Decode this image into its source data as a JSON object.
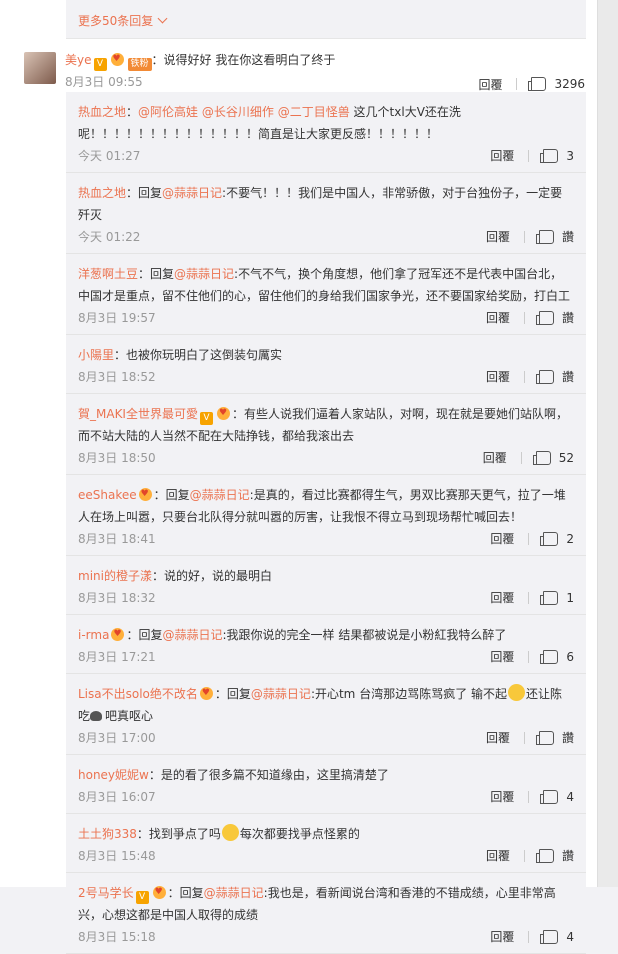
{
  "more": {
    "label": "更多50条回复"
  },
  "main": {
    "user": "美ye",
    "fan_badge": "铁粉",
    "text": "：说得好好 我在你这看明白了终于",
    "time": "8月3日 09:55",
    "reply_label": "回覆",
    "likes": "3296"
  },
  "replies": [
    {
      "user": "热血之地",
      "segments": [
        {
          "t": "："
        },
        {
          "t": "@阿伦高娃",
          "link": true
        },
        {
          "t": " "
        },
        {
          "t": "@长谷川细作",
          "link": true
        },
        {
          "t": " "
        },
        {
          "t": "@二丁目怪兽",
          "link": true
        },
        {
          "t": " 这几个txl大V还在洗呢！！！！！！！！！！！！！！简直是让大家更反感！！！！！！"
        }
      ],
      "time": "今天 01:27",
      "reply_label": "回覆",
      "likes": "3"
    },
    {
      "user": "热血之地",
      "segments": [
        {
          "t": "：回复"
        },
        {
          "t": "@蒜蒜日记",
          "link": true
        },
        {
          "t": ":不要气！！！我们是中国人，非常骄傲，对于台独份子，一定要歼灭"
        }
      ],
      "time": "今天 01:22",
      "reply_label": "回覆",
      "likes": "讚"
    },
    {
      "user": "洋葱啊土豆",
      "segments": [
        {
          "t": "：回复"
        },
        {
          "t": "@蒜蒜日记",
          "link": true
        },
        {
          "t": ":不气不气，换个角度想，他们拿了冠军还不是代表中国台北，中国才是重点，留不住他们的心，留住他们的身给我们国家争光，还不要国家给奖励，打白工"
        }
      ],
      "time": "8月3日 19:57",
      "reply_label": "回覆",
      "likes": "讚"
    },
    {
      "user": "小陽里",
      "segments": [
        {
          "t": "：也被你玩明白了这倒装句厲实"
        }
      ],
      "time": "8月3日 18:52",
      "reply_label": "回覆",
      "likes": "讚"
    },
    {
      "user": "賀_MAKI全世界最可愛",
      "vbadge": true,
      "heart": true,
      "segments": [
        {
          "t": "：有些人说我们逼着人家站队，对啊，现在就是要她们站队啊，而不站大陆的人当然不配在大陆挣钱，都给我滚出去"
        }
      ],
      "time": "8月3日 18:50",
      "reply_label": "回覆",
      "likes": "52"
    },
    {
      "user": "eeShakee",
      "heart": true,
      "segments": [
        {
          "t": "：回复"
        },
        {
          "t": "@蒜蒜日记",
          "link": true
        },
        {
          "t": ":是真的，看过比赛都得生气，男双比赛那天更气，拉了一堆人在场上叫嚣，只要台北队得分就叫嚣的厉害，让我恨不得立马到现场帮忙喊回去！"
        }
      ],
      "time": "8月3日 18:41",
      "reply_label": "回覆",
      "likes": "2"
    },
    {
      "user": "mini的橙子漾",
      "segments": [
        {
          "t": "：说的好，说的最明白"
        }
      ],
      "time": "8月3日 18:32",
      "reply_label": "回覆",
      "likes": "1"
    },
    {
      "user": "i-rma",
      "heart": true,
      "segments": [
        {
          "t": "：回复"
        },
        {
          "t": "@蒜蒜日记",
          "link": true
        },
        {
          "t": ":我跟你说的完全一样 结果都被说是小粉紅我特么醉了"
        }
      ],
      "time": "8月3日 17:21",
      "reply_label": "回覆",
      "likes": "6"
    },
    {
      "user": "Lisa不出solo绝不改名",
      "heart": true,
      "segments": [
        {
          "t": "：回复"
        },
        {
          "t": "@蒜蒜日记",
          "link": true
        },
        {
          "t": ":开心tm 台湾那边骂陈骂疯了 输不起"
        },
        {
          "emoji": "smile"
        },
        {
          "t": "还让陈吃"
        },
        {
          "emoji": "poop"
        },
        {
          "t": "吧真呕心"
        }
      ],
      "time": "8月3日 17:00",
      "reply_label": "回覆",
      "likes": "讚"
    },
    {
      "user": "honey妮妮w",
      "segments": [
        {
          "t": "：是的看了很多篇不知道缘由，这里搞清楚了"
        }
      ],
      "time": "8月3日 16:07",
      "reply_label": "回覆",
      "likes": "4"
    },
    {
      "user": "土土狗338",
      "segments": [
        {
          "t": "：找到爭点了吗"
        },
        {
          "emoji": "laugh"
        },
        {
          "t": "每次都要找爭点怪累的"
        }
      ],
      "time": "8月3日 15:48",
      "reply_label": "回覆",
      "likes": "讚"
    },
    {
      "user": "2号马学长",
      "vbadge": true,
      "heart": true,
      "segments": [
        {
          "t": "：回复"
        },
        {
          "t": "@蒜蒜日记",
          "link": true
        },
        {
          "t": ":我也是，看新闻说台湾和香港的不错成绩，心里非常高兴，心想这都是中国人取得的成绩"
        }
      ],
      "time": "8月3日 15:18",
      "reply_label": "回覆",
      "likes": "4"
    }
  ]
}
